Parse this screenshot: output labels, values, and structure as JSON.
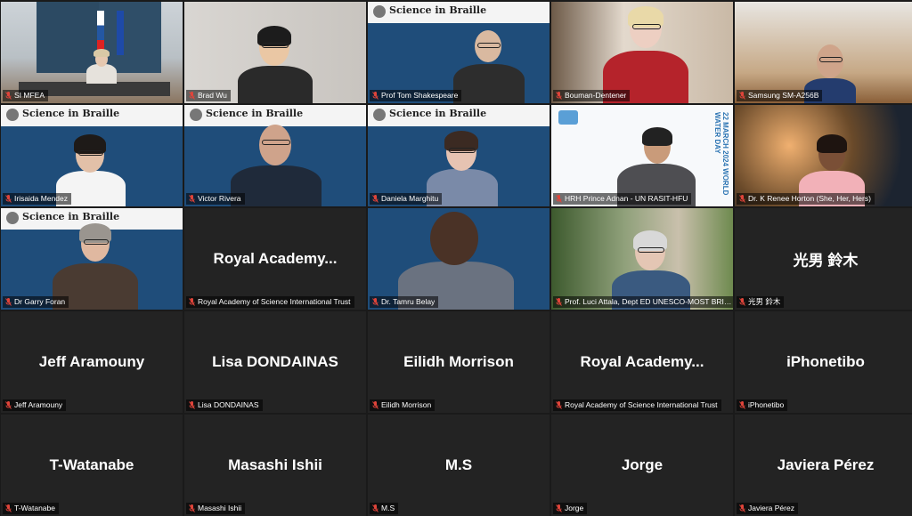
{
  "meeting": {
    "participants": [
      {
        "name": "SI MFEA",
        "display": "",
        "speaking": true,
        "video": "room"
      },
      {
        "name": "Brad Wu",
        "display": "",
        "video": "brad"
      },
      {
        "name": "Prof Tom Shakespeare",
        "display": "",
        "video": "braille-tom",
        "banner": "Science in Braille"
      },
      {
        "name": "Bouman-Dentener",
        "display": "",
        "video": "bouman"
      },
      {
        "name": "Samsung SM-A256B",
        "display": "",
        "video": "samsung"
      },
      {
        "name": "Irisaida Mendez",
        "display": "",
        "video": "braille-iris",
        "banner": "Science in Braille"
      },
      {
        "name": "Victor Rivera",
        "display": "",
        "video": "braille-victor",
        "banner": "Science in Braille"
      },
      {
        "name": "Daniela Marghitu",
        "display": "",
        "video": "braille-daniela",
        "banner": "Science in Braille"
      },
      {
        "name": "HRH Prince Adnan - UN RASIT-HFU",
        "display": "",
        "video": "adnan",
        "vertical_caption": "22 MARCH 2024 WORLD WATER DAY"
      },
      {
        "name": "Dr. K Renee Horton (She, Her, Hers)",
        "display": "",
        "video": "horton"
      },
      {
        "name": "Dr Garry Foran",
        "display": "",
        "video": "braille-garry",
        "banner": "Science in Braille"
      },
      {
        "name": "Royal Academy of Science International Trust",
        "display": "Royal  Academy...",
        "video": "none"
      },
      {
        "name": "Dr. Tamru Belay",
        "display": "",
        "video": "braille-tamru"
      },
      {
        "name": "Prof. Luci Attala, Dept ED UNESCO-MOST BRIDG...",
        "display": "",
        "video": "luci"
      },
      {
        "name": "光男 鈴木",
        "display": "光男 鈴木",
        "video": "none"
      },
      {
        "name": "Jeff Aramouny",
        "display": "Jeff Aramouny",
        "video": "none"
      },
      {
        "name": "Lisa DONDAINAS",
        "display": "Lisa DONDAINAS",
        "video": "none"
      },
      {
        "name": "Eilidh Morrison",
        "display": "Eilidh Morrison",
        "video": "none"
      },
      {
        "name": "Royal Academy of Science International Trust",
        "display": "Royal  Academy...",
        "video": "none"
      },
      {
        "name": "iPhonetibo",
        "display": "iPhonetibo",
        "video": "none"
      },
      {
        "name": "T-Watanabe",
        "display": "T-Watanabe",
        "video": "none"
      },
      {
        "name": "Masashi Ishii",
        "display": "Masashi Ishii",
        "video": "none"
      },
      {
        "name": "M.S",
        "display": "M.S",
        "video": "none"
      },
      {
        "name": "Jorge",
        "display": "Jorge",
        "video": "none"
      },
      {
        "name": "Javiera Pérez",
        "display": "Javiera Pérez",
        "video": "none"
      }
    ]
  },
  "icons": {
    "muted": "mic-muted-icon"
  },
  "colors": {
    "speaking_border": "#2ecc5a",
    "muted_mic": "#e0443a",
    "tile_bg": "#232323",
    "braille_navy": "#1f4d7a"
  }
}
